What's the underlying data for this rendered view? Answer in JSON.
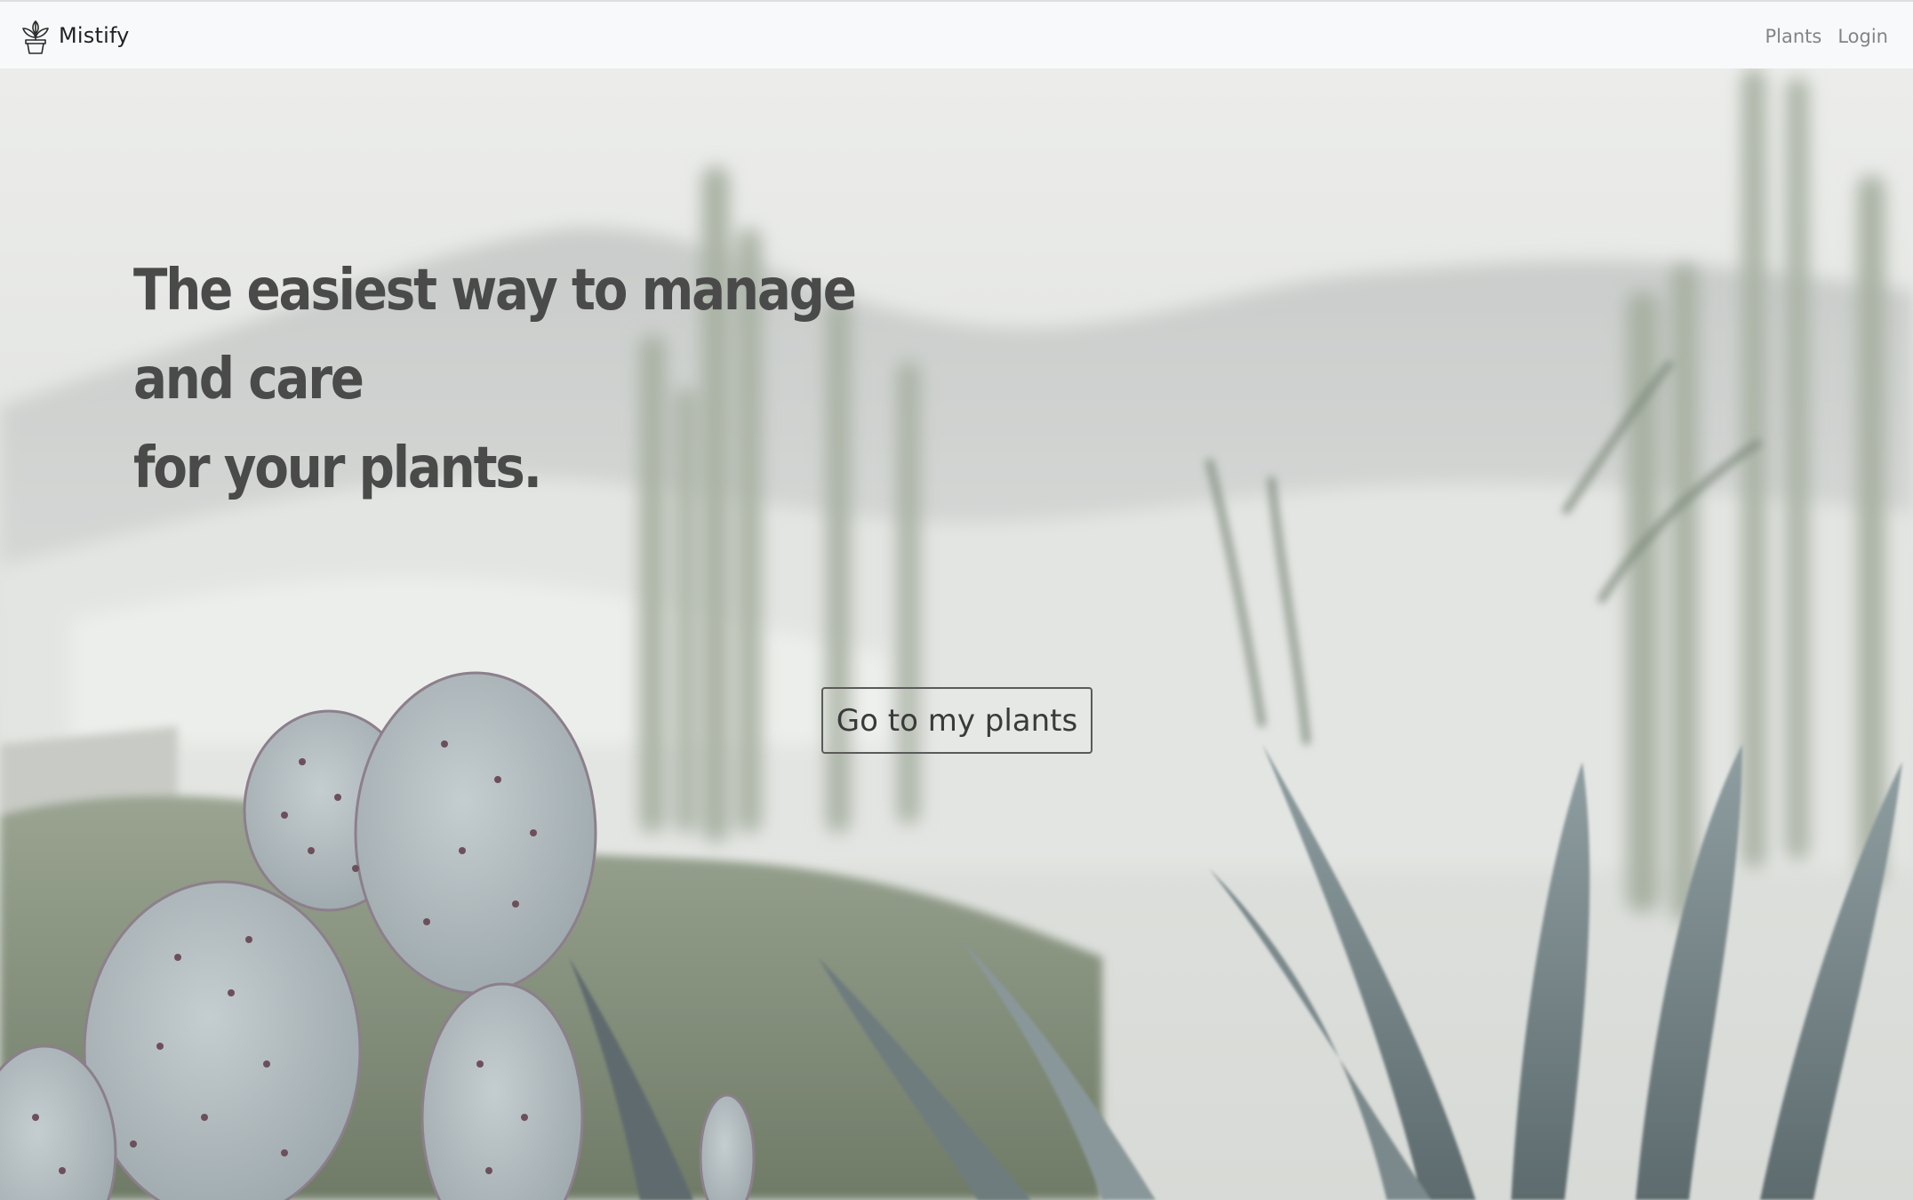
{
  "navbar": {
    "brand_name": "Mistify",
    "brand_icon": "potted-plant-icon",
    "links": [
      {
        "label": "Plants"
      },
      {
        "label": "Login"
      }
    ]
  },
  "hero": {
    "headline": "The easiest way to manage and care\nfor your plants.",
    "cta_label": "Go to my plants",
    "background": "desert-cactus-photo"
  },
  "colors": {
    "navbar_bg": "#f8f9fa",
    "headline": "#4a4a4a",
    "nav_link": "#808589",
    "button_border": "#5a5a5a"
  }
}
